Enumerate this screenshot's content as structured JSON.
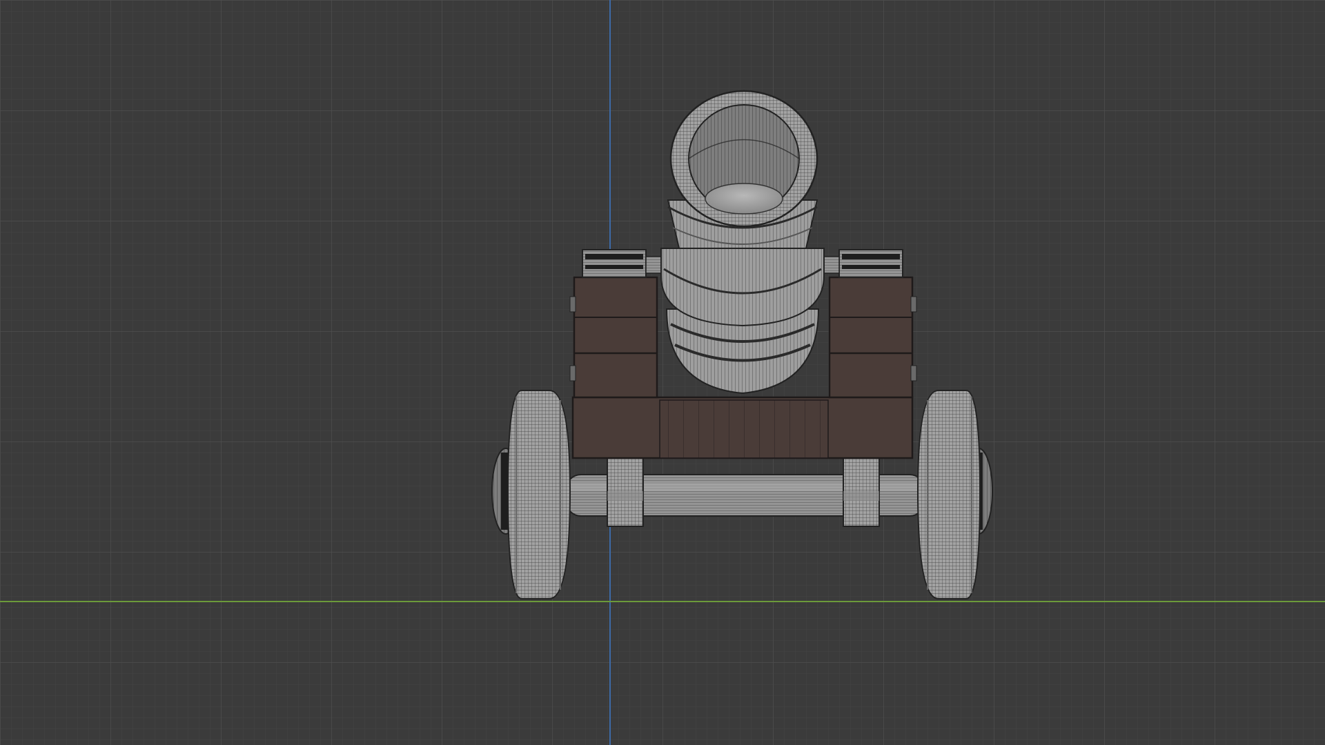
{
  "viewport": {
    "background_color": "#3b3b3b",
    "grid_minor_color": "#444444",
    "grid_major_color": "#4d4d4d",
    "x_axis_color": "#6c9a3a",
    "z_axis_color": "#3d6aa6"
  },
  "model": {
    "object": "cannon",
    "wood_color": "#4a3c38",
    "metal_color": "#9c9c9c",
    "wire_color": "#2a2a2a"
  }
}
